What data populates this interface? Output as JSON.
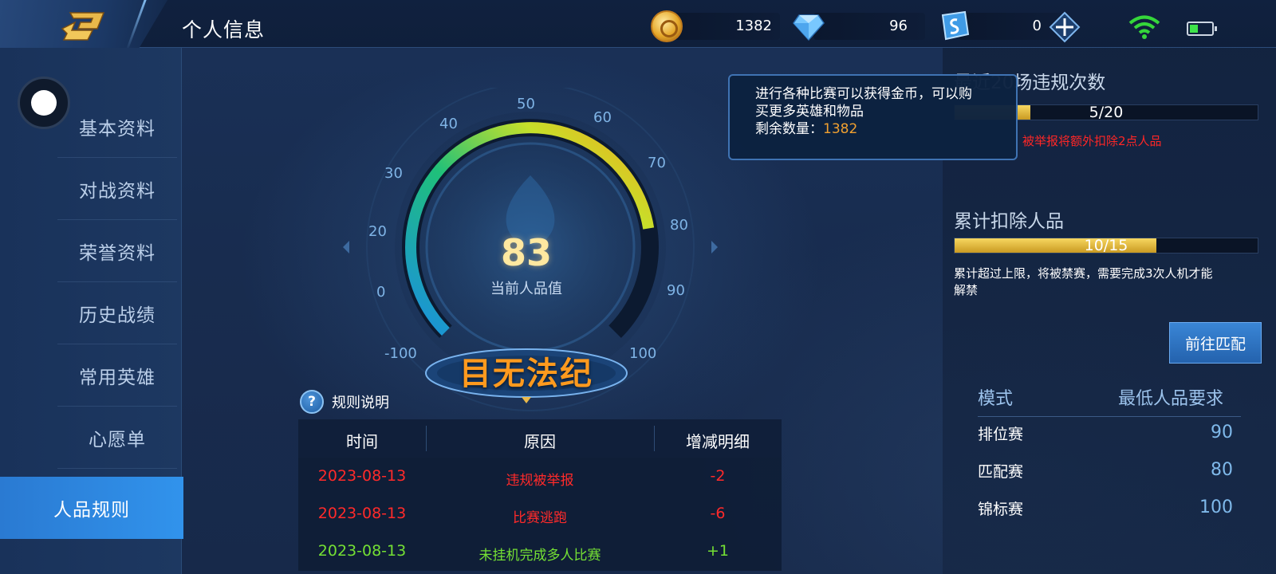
{
  "header": {
    "title": "个人信息",
    "currencies": {
      "gold": "1382",
      "diamond": "96",
      "voucher": "0"
    }
  },
  "sidebar": {
    "items": [
      {
        "label": "基本资料",
        "active": false
      },
      {
        "label": "对战资料",
        "active": false
      },
      {
        "label": "荣誉资料",
        "active": false
      },
      {
        "label": "历史战绩",
        "active": false
      },
      {
        "label": "常用英雄",
        "active": false
      },
      {
        "label": "心愿单",
        "active": false
      },
      {
        "label": "人品规则",
        "active": true
      }
    ]
  },
  "gauge": {
    "score": "83",
    "score_label": "当前人品值",
    "status": "目无法纪",
    "ticks": [
      "-100",
      "0",
      "20",
      "30",
      "40",
      "50",
      "60",
      "70",
      "80",
      "90",
      "100"
    ],
    "fill_to": 80
  },
  "rules": {
    "link_label": "规则说明",
    "help_glyph": "?",
    "columns": [
      "时间",
      "原因",
      "增减明细"
    ],
    "rows": [
      {
        "time": "2023-08-13",
        "reason": "违规被举报",
        "delta": "-2",
        "tone": "red"
      },
      {
        "time": "2023-08-13",
        "reason": "比赛逃跑",
        "delta": "-6",
        "tone": "red"
      },
      {
        "time": "2023-08-13",
        "reason": "未挂机完成多人比赛",
        "delta": "+1",
        "tone": "green"
      }
    ]
  },
  "tooltip": {
    "line1": "进行各种比赛可以获得金币，可以购",
    "line2": "买更多英雄和物品",
    "line3_label": "剩余数量：",
    "line3_value": "1382"
  },
  "right_panel": {
    "violations_title": "最近20场违规次数",
    "violations_bar": {
      "label": "5/20",
      "fraction": 0.25
    },
    "violations_warning": "被举报将额外扣除2点人品",
    "deduct_title": "累计扣除人品",
    "deduct_bar": {
      "label": "10/15",
      "fraction": 0.667
    },
    "deduct_note_line1": "累计超过上限，将被禁赛，需要完成3次人机才能",
    "deduct_note_line2": "解禁",
    "match_button": "前往匹配",
    "requirements": {
      "head_mode": "模式",
      "head_min": "最低人品要求",
      "rows": [
        {
          "mode": "排位赛",
          "min": "90"
        },
        {
          "mode": "匹配赛",
          "min": "80"
        },
        {
          "mode": "锦标赛",
          "min": "100"
        }
      ]
    }
  },
  "colors": {
    "accent": "#3193ec",
    "penalty": "#ff2a2a",
    "bonus": "#74e034",
    "status": "#ff9a1e",
    "bar_fill": "#e8c240"
  },
  "icons": [
    "back-arrow-icon",
    "gold-coin-icon",
    "diamond-icon",
    "voucher-icon",
    "plus-icon",
    "wifi-icon",
    "battery-icon",
    "help-icon"
  ]
}
